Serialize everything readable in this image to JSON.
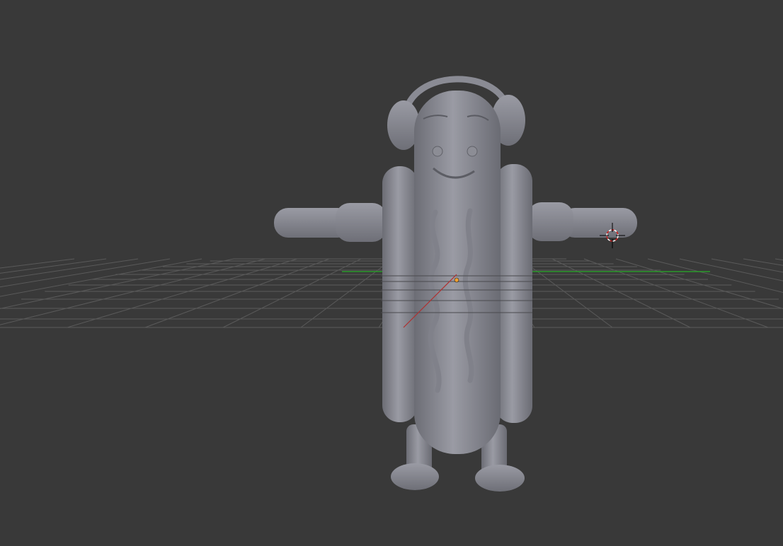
{
  "viewport": {
    "background": "#393939",
    "grid_color": "#5a5a5a",
    "x_axis_color": "#b03030",
    "y_axis_color": "#2a9a2a",
    "model_color": "#8a8b94",
    "origin_color": "#f0a030",
    "objects": [
      "hotdog-character"
    ],
    "icons": [
      "3d-cursor-icon",
      "object-origin-icon"
    ]
  }
}
